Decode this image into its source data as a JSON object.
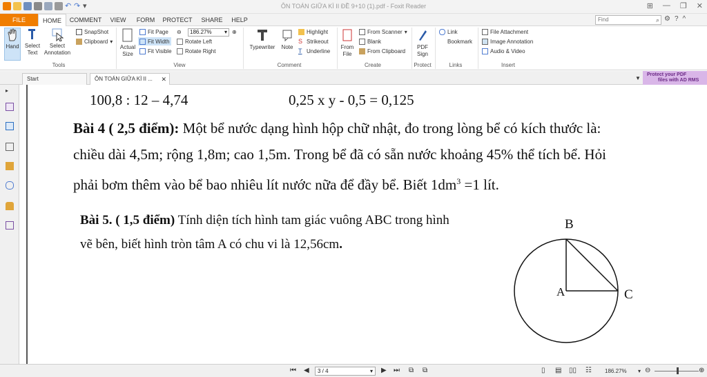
{
  "window": {
    "title": "ÔN TOÁN GIỮA KÌ II ĐỀ 9+10 (1).pdf - Foxit Reader"
  },
  "ribbon_tabs": [
    "FILE",
    "HOME",
    "COMMENT",
    "VIEW",
    "FORM",
    "PROTECT",
    "SHARE",
    "HELP"
  ],
  "search": {
    "placeholder": "Find"
  },
  "ribbon": {
    "tools": {
      "label": "Tools",
      "hand": "Hand",
      "select_text_1": "Select",
      "select_text_2": "Text",
      "select_ann_1": "Select",
      "select_ann_2": "Annotation",
      "snapshot": "SnapShot",
      "clipboard": "Clipboard"
    },
    "view": {
      "label": "View",
      "actual_size_1": "Actual",
      "actual_size_2": "Size",
      "fit_page": "Fit Page",
      "fit_width": "Fit Width",
      "fit_visible": "Fit Visible",
      "zoom": "186.27%",
      "rotate_left": "Rotate Left",
      "rotate_right": "Rotate Right"
    },
    "comment": {
      "label": "Comment",
      "typewriter": "Typewriter",
      "note": "Note",
      "highlight": "Highlight",
      "strikeout": "Strikeout",
      "underline": "Underline"
    },
    "create": {
      "label": "Create",
      "from_file_1": "From",
      "from_file_2": "File",
      "from_scanner": "From Scanner",
      "blank": "Blank",
      "from_clipboard": "From Clipboard"
    },
    "protect": {
      "label": "Protect",
      "pdf_sign_1": "PDF",
      "pdf_sign_2": "Sign"
    },
    "links": {
      "label": "Links",
      "link": "Link",
      "bookmark": "Bookmark"
    },
    "insert": {
      "label": "Insert",
      "file_attachment": "File Attachment",
      "image_annotation": "Image Annotation",
      "audio_video": "Audio & Video"
    }
  },
  "doc_tabs": {
    "start": "Start",
    "document": "ÔN TOÁN GIỮA KÌ II ..."
  },
  "banner": {
    "line1": "Protect your PDF",
    "line2": "files with AD RMS"
  },
  "page": {
    "line_top_left": "100,8 : 12 – 4,74",
    "line_top_right": "0,25 x y - 0,5 = 0,125",
    "bai4_title": "Bài 4 ( 2,5 điểm):",
    "bai4_line1": " Một bể nước dạng hình hộp chữ nhật, đo trong lòng bể có kích thước là:",
    "bai4_line2": "chiều dài 4,5m; rộng 1,8m; cao 1,5m. Trong bể đã có sẵn nước khoảng 45% thể tích bể. Hỏi",
    "bai4_line3a": "phải bơm thêm vào bể bao nhiêu lít nước nữa để đầy bể. Biết 1dm",
    "bai4_sup": "3",
    "bai4_line3b": " =1 lít.",
    "bai5_title": "Bài 5. ( 1,5 điểm)",
    "bai5_line1": " Tính diện tích hình tam giác vuông ABC trong hình",
    "bai5_line2": "vẽ bên, biết hình tròn tâm A có chu vi là 12,56cm",
    "bai5_period": ".",
    "figure": {
      "label_a": "A",
      "label_b": "B",
      "label_c": "C"
    }
  },
  "status": {
    "page": "3 / 4",
    "zoom": "186.27%"
  }
}
